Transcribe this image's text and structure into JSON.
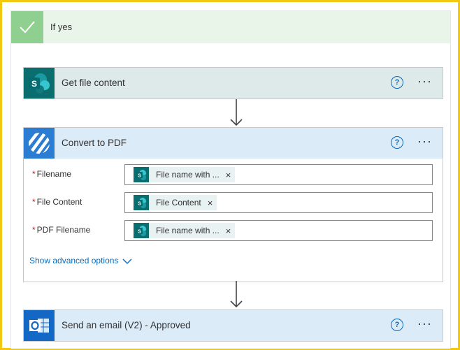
{
  "branch": {
    "label": "If yes",
    "icon": "checkmark-icon"
  },
  "cards": {
    "get_file": {
      "title": "Get file content",
      "icon": "sharepoint-icon"
    },
    "convert": {
      "title": "Convert to PDF",
      "icon": "striped-circle-icon",
      "fields": [
        {
          "label": "Filename",
          "required": "*",
          "token": "File name with ...",
          "token_icon": "sharepoint-icon"
        },
        {
          "label": "File Content",
          "required": "*",
          "token": "File Content",
          "token_icon": "sharepoint-icon"
        },
        {
          "label": "PDF Filename",
          "required": "*",
          "token": "File name with ...",
          "token_icon": "sharepoint-icon"
        }
      ],
      "advanced": "Show advanced options"
    },
    "send_email": {
      "title": "Send an email (V2) - Approved",
      "icon": "outlook-icon"
    }
  },
  "help_label": "?",
  "more_label": "···",
  "remove_label": "×",
  "colors": {
    "highlight_border": "#f2c811",
    "link": "#0b6cbd",
    "sharepoint": "#0b6e6e",
    "required": "#a4262c"
  }
}
